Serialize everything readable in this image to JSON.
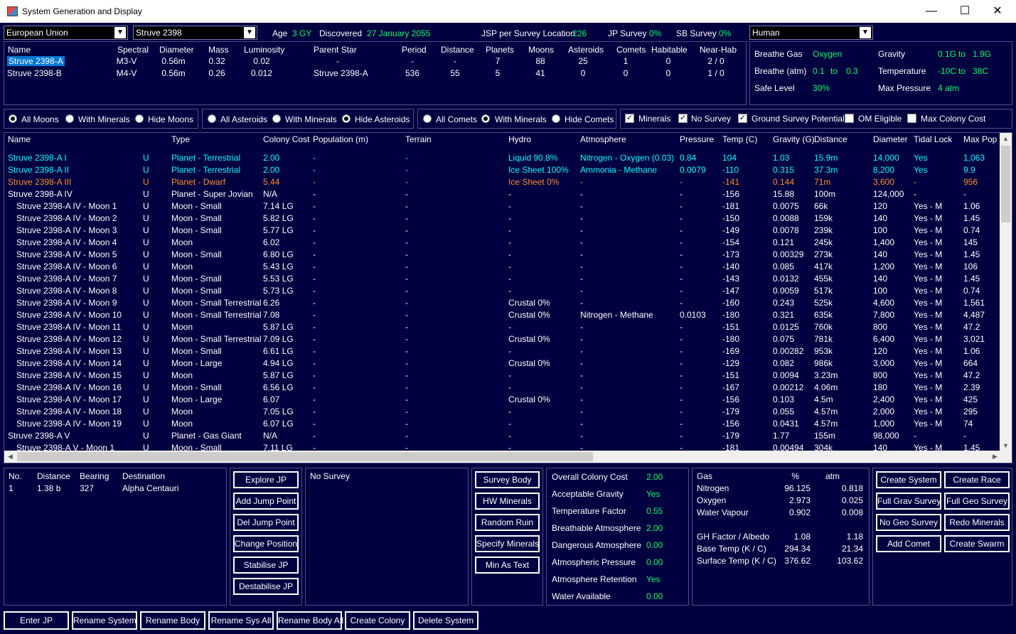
{
  "window": {
    "title": "System Generation and Display",
    "min": "—",
    "max": "☐",
    "close": "✕"
  },
  "top": {
    "empire": "European Union",
    "system": "Struve 2398",
    "age_label": "Age",
    "age_value": "3 GY",
    "discovered_label": "Discovered",
    "discovered_value": "27 January 2055",
    "jsp_label": "JSP per Survey Location",
    "jsp_value": "226",
    "jp_label": "JP Survey",
    "jp_value": "0%",
    "sb_label": "SB Survey",
    "sb_value": "0%",
    "race": "Human"
  },
  "stars": {
    "headers": [
      "Name",
      "Spectral",
      "Diameter",
      "Mass",
      "Luminosity",
      "Parent Star",
      "Period",
      "Distance",
      "Planets",
      "Moons",
      "Asteroids",
      "Comets",
      "Habitable",
      "Near-Hab"
    ],
    "rows": [
      [
        "Struve 2398-A",
        "M3-V",
        "0.56m",
        "0.32",
        "0.02",
        "-",
        "-",
        "-",
        "7",
        "88",
        "25",
        "1",
        "0",
        "2 / 0"
      ],
      [
        "Struve 2398-B",
        "M4-V",
        "0.56m",
        "0.26",
        "0.012",
        "Struve 2398-A",
        "536",
        "55",
        "5",
        "41",
        "0",
        "0",
        "0",
        "1 / 0"
      ]
    ]
  },
  "env": {
    "breathe_gas_label": "Breathe Gas",
    "breathe_gas": "Oxygen",
    "gravity_label": "Gravity",
    "gravity_min": "0.1G",
    "gravity_to": "to",
    "gravity_max": "1.9G",
    "breathe_atm_label": "Breathe (atm)",
    "breathe_min": "0.1",
    "breathe_to": "to",
    "breathe_max": "0.3",
    "temp_label": "Temperature",
    "temp_min": "-10C",
    "temp_to": "to",
    "temp_max": "38C",
    "safe_label": "Safe Level",
    "safe": "30%",
    "maxp_label": "Max Pressure",
    "maxp": "4 atm"
  },
  "filters": {
    "moons": [
      "All Moons",
      "With Minerals",
      "Hide Moons"
    ],
    "asteroids": [
      "All Asteroids",
      "With Minerals",
      "Hide Asteroids"
    ],
    "comets": [
      "All Comets",
      "With Minerals",
      "Hide Comets"
    ],
    "checks": [
      "Minerals",
      "No Survey",
      "Ground Survey Potential",
      "OM Eligible",
      "Max Colony Cost"
    ]
  },
  "bodies": {
    "headers": [
      "Name",
      "Type",
      "Colony Cost",
      "Population (m)",
      "Terrain",
      "Hydro",
      "Atmosphere",
      "Pressure",
      "Temp (C)",
      "Gravity (G)",
      "Distance",
      "Diameter",
      "Tidal Lock",
      "Max Pop"
    ],
    "rows": [
      {
        "c": "cy",
        "d": [
          "Struve 2398-A I",
          "U",
          "Planet - Terrestrial",
          "2.00",
          "-",
          "-",
          "Liquid 90.8%",
          "Nitrogen - Oxygen (0.03)",
          "0.84",
          "104",
          "1.03",
          "15.9m",
          "14,000",
          "Yes",
          "1,063"
        ]
      },
      {
        "c": "cy",
        "d": [
          "Struve 2398-A II",
          "U",
          "Planet - Terrestrial",
          "2.00",
          "-",
          "-",
          "Ice Sheet 100%",
          "Ammonia - Methane",
          "0.0079",
          "-110",
          "0.315",
          "37.3m",
          "8,200",
          "Yes",
          "9.9"
        ]
      },
      {
        "c": "or",
        "d": [
          "Struve 2398-A III",
          "U",
          "Planet - Dwarf",
          "5.44",
          "-",
          "-",
          "Ice Sheet 0%",
          "-",
          "-",
          "-141",
          "0.144",
          "71m",
          "3,600",
          "-",
          "956"
        ]
      },
      {
        "c": "",
        "d": [
          "Struve 2398-A IV",
          "U",
          "Planet - Super Jovian",
          "N/A",
          "-",
          "-",
          "-",
          "-",
          "-",
          "-156",
          "15.88",
          "100m",
          "124,000",
          "-",
          "-"
        ]
      },
      {
        "c": "",
        "d": [
          "Struve 2398-A IV - Moon 1",
          "U",
          "Moon - Small",
          "7.14 LG",
          "-",
          "-",
          "-",
          "-",
          "-",
          "-181",
          "0.0075",
          "66k",
          "120",
          "Yes - M",
          "1.06"
        ]
      },
      {
        "c": "",
        "d": [
          "Struve 2398-A IV - Moon 2",
          "U",
          "Moon - Small",
          "5.82 LG",
          "-",
          "-",
          "-",
          "-",
          "-",
          "-150",
          "0.0088",
          "159k",
          "140",
          "Yes - M",
          "1.45"
        ]
      },
      {
        "c": "",
        "d": [
          "Struve 2398-A IV - Moon 3",
          "U",
          "Moon - Small",
          "5.77 LG",
          "-",
          "-",
          "-",
          "-",
          "-",
          "-149",
          "0.0078",
          "239k",
          "100",
          "Yes - M",
          "0.74"
        ]
      },
      {
        "c": "",
        "d": [
          "Struve 2398-A IV - Moon 4",
          "U",
          "Moon",
          "6.02",
          "-",
          "-",
          "-",
          "-",
          "-",
          "-154",
          "0.121",
          "245k",
          "1,400",
          "Yes - M",
          "145"
        ]
      },
      {
        "c": "",
        "d": [
          "Struve 2398-A IV - Moon 5",
          "U",
          "Moon - Small",
          "6.80 LG",
          "-",
          "-",
          "-",
          "-",
          "-",
          "-173",
          "0.00329",
          "273k",
          "140",
          "Yes - M",
          "1.45"
        ]
      },
      {
        "c": "",
        "d": [
          "Struve 2398-A IV - Moon 6",
          "U",
          "Moon",
          "5.43 LG",
          "-",
          "-",
          "-",
          "-",
          "-",
          "-140",
          "0.085",
          "417k",
          "1,200",
          "Yes - M",
          "106"
        ]
      },
      {
        "c": "",
        "d": [
          "Struve 2398-A IV - Moon 7",
          "U",
          "Moon - Small",
          "5.53 LG",
          "-",
          "-",
          "-",
          "-",
          "-",
          "-143",
          "0.0132",
          "455k",
          "140",
          "Yes - M",
          "1.45"
        ]
      },
      {
        "c": "",
        "d": [
          "Struve 2398-A IV - Moon 8",
          "U",
          "Moon - Small",
          "5.73 LG",
          "-",
          "-",
          "-",
          "-",
          "-",
          "-147",
          "0.0059",
          "517k",
          "100",
          "Yes - M",
          "0.74"
        ]
      },
      {
        "c": "",
        "d": [
          "Struve 2398-A IV - Moon 9",
          "U",
          "Moon - Small Terrestrial",
          "6.26",
          "-",
          "-",
          "Crustal 0%",
          "-",
          "-",
          "-160",
          "0.243",
          "525k",
          "4,600",
          "Yes - M",
          "1,561"
        ]
      },
      {
        "c": "",
        "d": [
          "Struve 2398-A IV - Moon 10",
          "U",
          "Moon - Small Terrestrial",
          "7.08",
          "-",
          "-",
          "Crustal 0%",
          "Nitrogen - Methane",
          "0.0103",
          "-180",
          "0.321",
          "635k",
          "7,800",
          "Yes - M",
          "4,487"
        ]
      },
      {
        "c": "",
        "d": [
          "Struve 2398-A IV - Moon 11",
          "U",
          "Moon",
          "5.87 LG",
          "-",
          "-",
          "-",
          "-",
          "-",
          "-151",
          "0.0125",
          "760k",
          "800",
          "Yes - M",
          "47.2"
        ]
      },
      {
        "c": "",
        "d": [
          "Struve 2398-A IV - Moon 12",
          "U",
          "Moon - Small Terrestrial",
          "7.09 LG",
          "-",
          "-",
          "Crustal 0%",
          "-",
          "-",
          "-180",
          "0.075",
          "781k",
          "6,400",
          "Yes - M",
          "3,021"
        ]
      },
      {
        "c": "",
        "d": [
          "Struve 2398-A IV - Moon 13",
          "U",
          "Moon - Small",
          "6.61 LG",
          "-",
          "-",
          "-",
          "-",
          "-",
          "-169",
          "0.00282",
          "953k",
          "120",
          "Yes - M",
          "1.06"
        ]
      },
      {
        "c": "",
        "d": [
          "Struve 2398-A IV - Moon 14",
          "U",
          "Moon - Large",
          "4.94 LG",
          "-",
          "-",
          "Crustal 0%",
          "-",
          "-",
          "-129",
          "0.082",
          "986k",
          "3,000",
          "Yes - M",
          "664"
        ]
      },
      {
        "c": "",
        "d": [
          "Struve 2398-A IV - Moon 15",
          "U",
          "Moon",
          "5.87 LG",
          "-",
          "-",
          "-",
          "-",
          "-",
          "-151",
          "0.0094",
          "3.23m",
          "800",
          "Yes - M",
          "47.2"
        ]
      },
      {
        "c": "",
        "d": [
          "Struve 2398-A IV - Moon 16",
          "U",
          "Moon - Small",
          "6.56 LG",
          "-",
          "-",
          "-",
          "-",
          "-",
          "-167",
          "0.00212",
          "4.06m",
          "180",
          "Yes - M",
          "2.39"
        ]
      },
      {
        "c": "",
        "d": [
          "Struve 2398-A IV - Moon 17",
          "U",
          "Moon - Large",
          "6.07",
          "-",
          "-",
          "Crustal 0%",
          "-",
          "-",
          "-156",
          "0.103",
          "4.5m",
          "2,400",
          "Yes - M",
          "425"
        ]
      },
      {
        "c": "",
        "d": [
          "Struve 2398-A IV - Moon 18",
          "U",
          "Moon",
          "7.05 LG",
          "-",
          "-",
          "-",
          "-",
          "-",
          "-179",
          "0.055",
          "4.57m",
          "2,000",
          "Yes - M",
          "295"
        ]
      },
      {
        "c": "",
        "d": [
          "Struve 2398-A IV - Moon 19",
          "U",
          "Moon",
          "6.07 LG",
          "-",
          "-",
          "-",
          "-",
          "-",
          "-156",
          "0.0431",
          "4.57m",
          "1,000",
          "Yes - M",
          "74"
        ]
      },
      {
        "c": "",
        "d": [
          "Struve 2398-A V",
          "U",
          "Planet - Gas Giant",
          "N/A",
          "-",
          "-",
          "-",
          "-",
          "-",
          "-179",
          "1.77",
          "155m",
          "98,000",
          "-",
          "-"
        ]
      },
      {
        "c": "",
        "d": [
          "Struve 2398-A V - Moon 1",
          "U",
          "Moon - Small",
          "7.11 LG",
          "-",
          "-",
          "-",
          "-",
          "-",
          "-181",
          "0.00494",
          "304k",
          "140",
          "Yes - M",
          "1.45"
        ]
      }
    ]
  },
  "jump": {
    "headers": [
      "No.",
      "Distance",
      "Bearing",
      "Destination"
    ],
    "rows": [
      [
        "1",
        "1.38 b",
        "327",
        "Alpha Centauri"
      ]
    ]
  },
  "jp_buttons": [
    "Explore JP",
    "Add Jump Point",
    "Del Jump Point",
    "Change Position",
    "Stabilise JP",
    "Destabilise JP"
  ],
  "survey_text": "No Survey",
  "survey_buttons": [
    "Survey Body",
    "HW Minerals",
    "Random Ruin",
    "Specify Minerals",
    "Min As Text"
  ],
  "colony": [
    [
      "Overall Colony Cost",
      "2.00"
    ],
    [
      "Acceptable Gravity",
      "Yes"
    ],
    [
      "Temperature Factor",
      "0.55"
    ],
    [
      "Breathable Atmosphere",
      "2.00"
    ],
    [
      "Dangerous Atmosphere",
      "0.00"
    ],
    [
      "Atmospheric Pressure",
      "0.00"
    ],
    [
      "Atmosphere Retention",
      "Yes"
    ],
    [
      "Water Available",
      "0.00"
    ]
  ],
  "gas": {
    "headers": [
      "Gas",
      "%",
      "atm"
    ],
    "rows": [
      [
        "Nitrogen",
        "96.125",
        "0.818"
      ],
      [
        "Oxygen",
        "2.973",
        "0.025"
      ],
      [
        "Water Vapour",
        "0.902",
        "0.008"
      ]
    ],
    "extra": [
      [
        "GH Factor / Albedo",
        "1.08",
        "1.18"
      ],
      [
        "Base Temp (K / C)",
        "294.34",
        "21.34"
      ],
      [
        "Surface Temp (K / C)",
        "376.62",
        "103.62"
      ]
    ]
  },
  "right_buttons": [
    "Create System",
    "Create Race",
    "Full Grav Survey",
    "Full Geo Survey",
    "No Geo Survey",
    "Redo Minerals",
    "Add Comet",
    "Create Swarm"
  ],
  "bottom_buttons": [
    "Enter JP",
    "Rename System",
    "Rename Body",
    "Rename Sys All",
    "Rename Body All",
    "Create Colony",
    "Delete System"
  ]
}
